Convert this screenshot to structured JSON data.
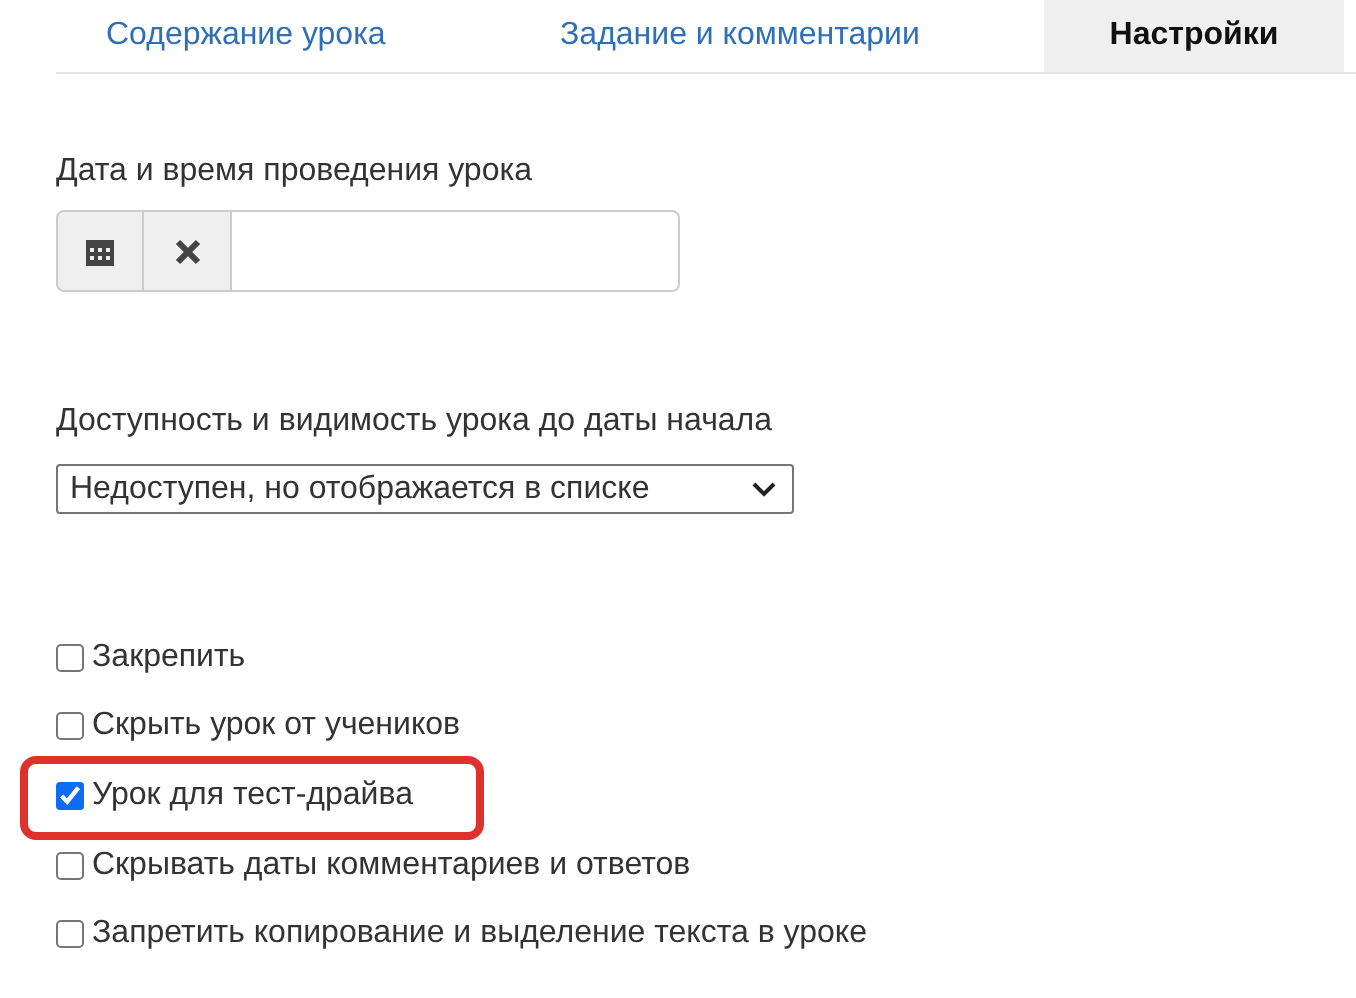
{
  "tabs": [
    {
      "label": "Содержание урока",
      "selected": false
    },
    {
      "label": "Задание и комментарии",
      "selected": false
    },
    {
      "label": "Настройки",
      "selected": true
    }
  ],
  "date_field": {
    "label": "Дата и время проведения урока"
  },
  "availability": {
    "label": "Доступность и видимость урока до даты начала",
    "value": "Недоступен, но отображается в списке"
  },
  "options": [
    {
      "label": "Закрепить",
      "checked": false,
      "highlighted": false
    },
    {
      "label": "Скрыть урок от учеников",
      "checked": false,
      "highlighted": false
    },
    {
      "label": "Урок для тест-драйва",
      "checked": true,
      "highlighted": true
    },
    {
      "label": "Скрывать даты комментариев и ответов",
      "checked": false,
      "highlighted": false
    },
    {
      "label": "Запретить копирование и выделение текста в уроке",
      "checked": false,
      "highlighted": false
    }
  ]
}
